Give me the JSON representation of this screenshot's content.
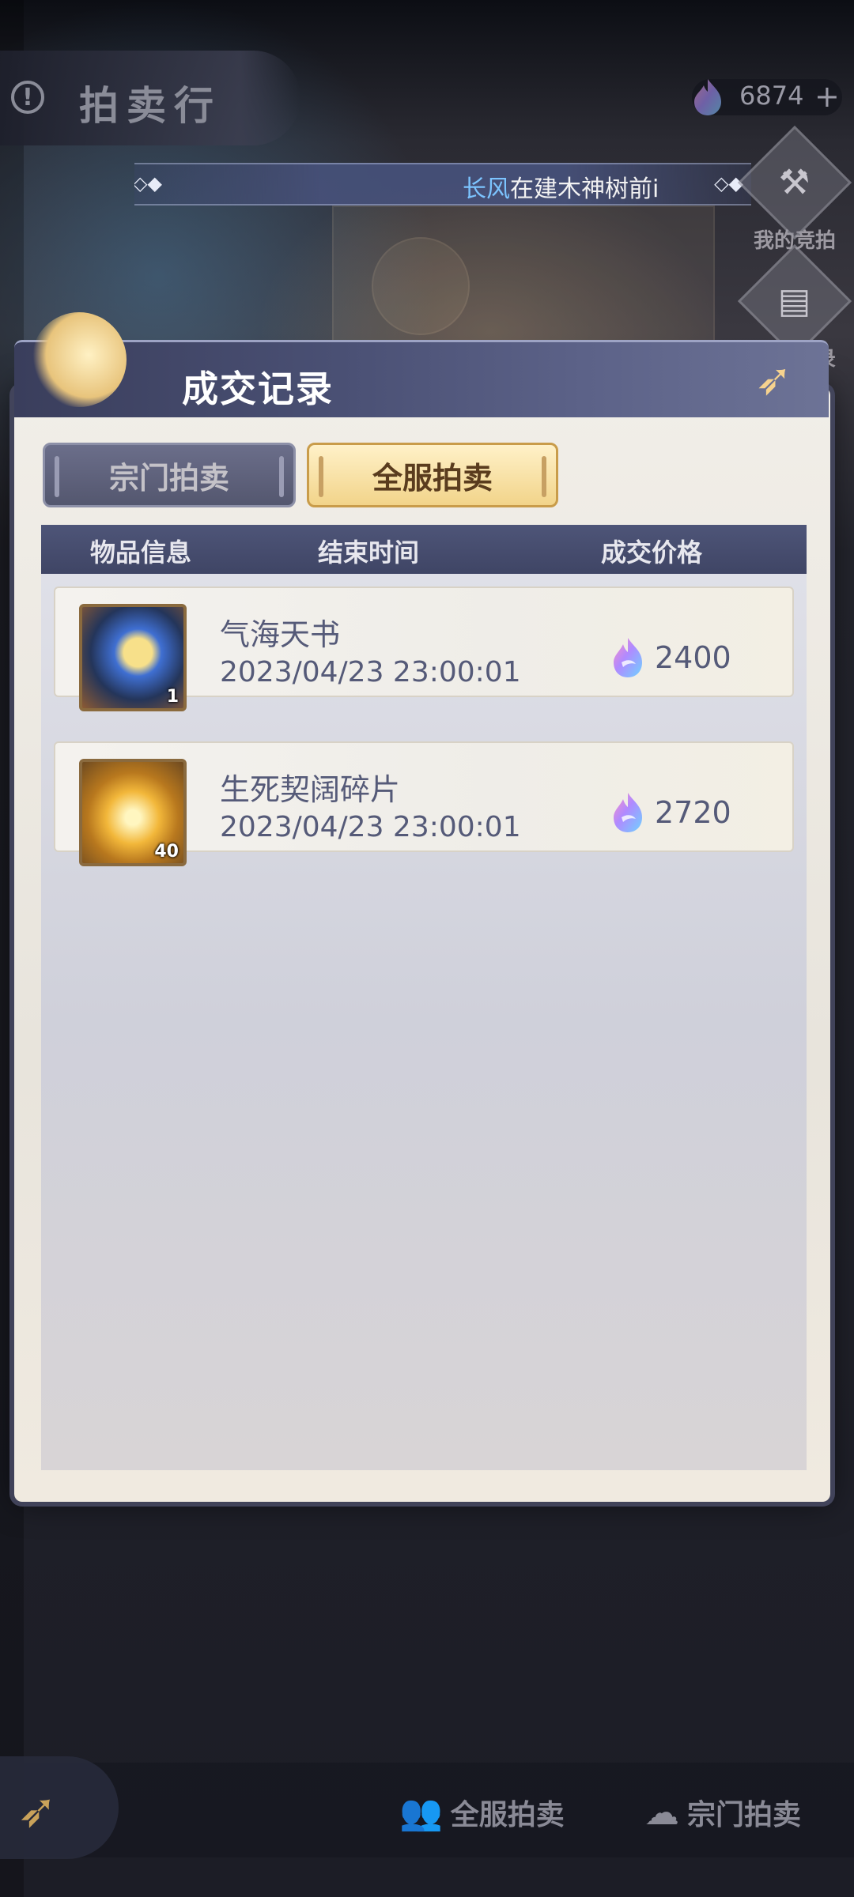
{
  "header": {
    "title": "拍卖行",
    "info_icon": "info-icon",
    "currency": {
      "icon": "spirit-flame-icon",
      "value": "6874",
      "plus": "+"
    }
  },
  "marquee": {
    "player_name": "长风",
    "text": "在建木神树前i"
  },
  "side_menu": [
    {
      "label": "我的竞拍",
      "icon": "gavel-icon"
    },
    {
      "label": "成交记录",
      "icon": "ledger-icon"
    }
  ],
  "modal": {
    "title": "成交记录",
    "tabs": [
      {
        "label": "宗门拍卖",
        "active": false
      },
      {
        "label": "全服拍卖",
        "active": true
      }
    ],
    "columns": [
      "物品信息",
      "结束时间",
      "成交价格"
    ],
    "records": [
      {
        "name": "气海天书",
        "time": "2023/04/23  23:00:01",
        "price": "2400",
        "count": "1",
        "icon": "book-icon"
      },
      {
        "name": "生死契阔碎片",
        "time": "2023/04/23  23:00:01",
        "price": "2720",
        "count": "40",
        "icon": "orb-icon"
      }
    ]
  },
  "bottom_nav": [
    {
      "label": "全服拍卖",
      "icon": "group-icon"
    },
    {
      "label": "宗门拍卖",
      "icon": "sect-icon"
    }
  ],
  "colors": {
    "accent_gold": "#f2d48a",
    "text_slate": "#555a78",
    "header_navy": "#4e5578"
  }
}
